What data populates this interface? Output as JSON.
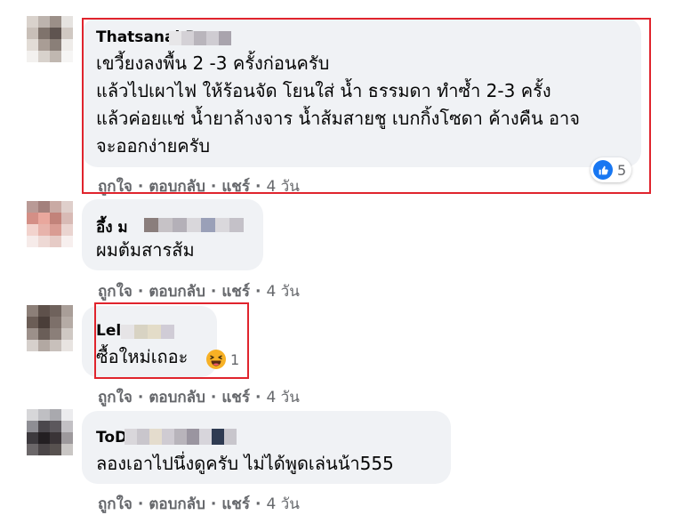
{
  "comments": [
    {
      "author": "Thatsanai Ram",
      "lines": [
        "เขวี้ยงลงพื้น 2 -3 ครั้งก่อนครับ",
        "แล้วไปเผาไฟ ให้ร้อนจัด โยนใส่ น้ำ ธรรมดา ทำซ้ำ 2-3 ครั้ง",
        "แล้วค่อยแช่ น้ำยาล้างจาร น้ำส้มสายชู เบกกิ้งโซดา ค้างคืน อาจ",
        "จะออกง่ายครับ"
      ],
      "reaction": {
        "icon": "like-icon",
        "count": "5"
      },
      "actions": {
        "like": "ถูกใจ",
        "reply": "ตอบกลับ",
        "share": "แชร์",
        "time": "4 วัน"
      }
    },
    {
      "author": "อึ้ง ม",
      "lines": [
        "ผมต้มสารส้ม"
      ],
      "actions": {
        "like": "ถูกใจ",
        "reply": "ตอบกลับ",
        "share": "แชร์",
        "time": "4 วัน"
      }
    },
    {
      "author": "Lel",
      "lines": [
        "ซื้อใหม่เถอะ"
      ],
      "reaction": {
        "icon": "haha-icon",
        "count": "1"
      },
      "actions": {
        "like": "ถูกใจ",
        "reply": "ตอบกลับ",
        "share": "แชร์",
        "time": "4 วัน"
      }
    },
    {
      "author": "ToD",
      "lines": [
        "ลองเอาไปนึ่งดูครับ ไม่ได้พูดเล่นน้า555"
      ],
      "actions": {
        "like": "ถูกใจ",
        "reply": "ตอบกลับ",
        "share": "แชร์",
        "time": "4 วัน"
      }
    }
  ],
  "separator": "·",
  "colors": {
    "bubble": "#f0f2f5",
    "text": "#050505",
    "secondary": "#65676b",
    "like_blue": "#1877f2",
    "highlight_red": "#e0242d"
  }
}
